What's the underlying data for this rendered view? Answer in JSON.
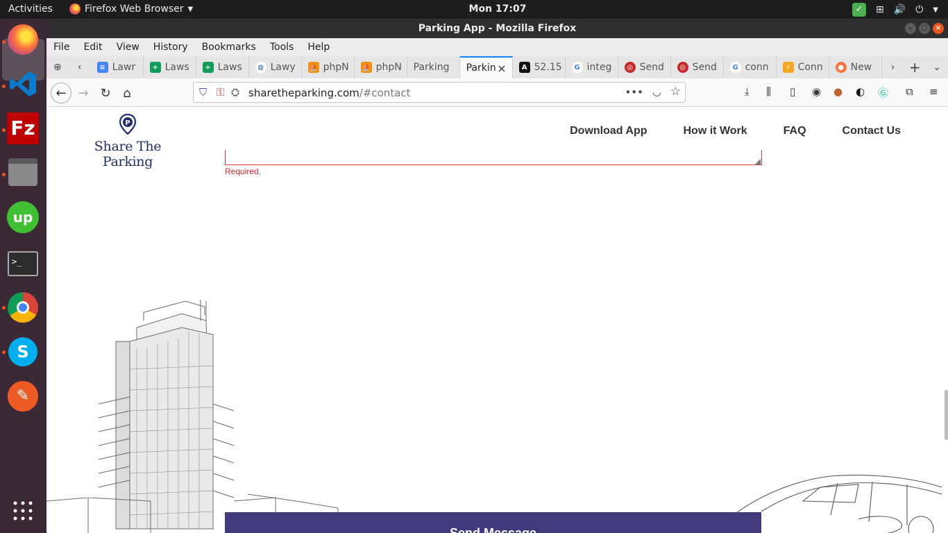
{
  "topbar": {
    "activities": "Activities",
    "app_name": "Firefox Web Browser",
    "clock": "Mon 17:07"
  },
  "window": {
    "title": "Parking App - Mozilla Firefox"
  },
  "menubar": {
    "items": [
      "File",
      "Edit",
      "View",
      "History",
      "Bookmarks",
      "Tools",
      "Help"
    ]
  },
  "tabs": [
    {
      "label": "Lawr",
      "icon": "docs-icon",
      "color": "#4285f4"
    },
    {
      "label": "Laws",
      "icon": "sheets-icon",
      "color": "#0f9d58"
    },
    {
      "label": "Laws",
      "icon": "sheets-icon",
      "color": "#0f9d58"
    },
    {
      "label": "Lawy",
      "icon": "globe-icon",
      "color": "#2a5d9f"
    },
    {
      "label": "phpN",
      "icon": "phpmyadmin-icon",
      "color": "#f29111"
    },
    {
      "label": "phpN",
      "icon": "phpmyadmin-icon",
      "color": "#f29111"
    },
    {
      "label": "Parking",
      "icon": "none",
      "color": "#ffffff"
    },
    {
      "label": "Parkin",
      "icon": "none",
      "color": "#ffffff",
      "active": true
    },
    {
      "label": "52.15",
      "icon": "a-icon",
      "color": "#111111"
    },
    {
      "label": "integ",
      "icon": "google-icon",
      "color": "#4285f4"
    },
    {
      "label": "Send",
      "icon": "send-icon",
      "color": "#c62828"
    },
    {
      "label": "Send",
      "icon": "send-icon",
      "color": "#c62828"
    },
    {
      "label": "conn",
      "icon": "google-icon",
      "color": "#4285f4"
    },
    {
      "label": "Conn",
      "icon": "conn-icon",
      "color": "#f5a623"
    },
    {
      "label": "New",
      "icon": "firefox-icon",
      "color": "#ff7139"
    }
  ],
  "urlbar": {
    "domain": "sharetheparking.com",
    "path": "/#contact"
  },
  "site": {
    "logo_text": "Share The Parking",
    "nav": [
      "Download App",
      "How it Work",
      "FAQ",
      "Contact Us"
    ],
    "required_text": "Required.",
    "send_button": "Send Message",
    "brand_color": "#1e2f6b",
    "button_color": "#413b7d",
    "error_color": "#d8262c"
  }
}
